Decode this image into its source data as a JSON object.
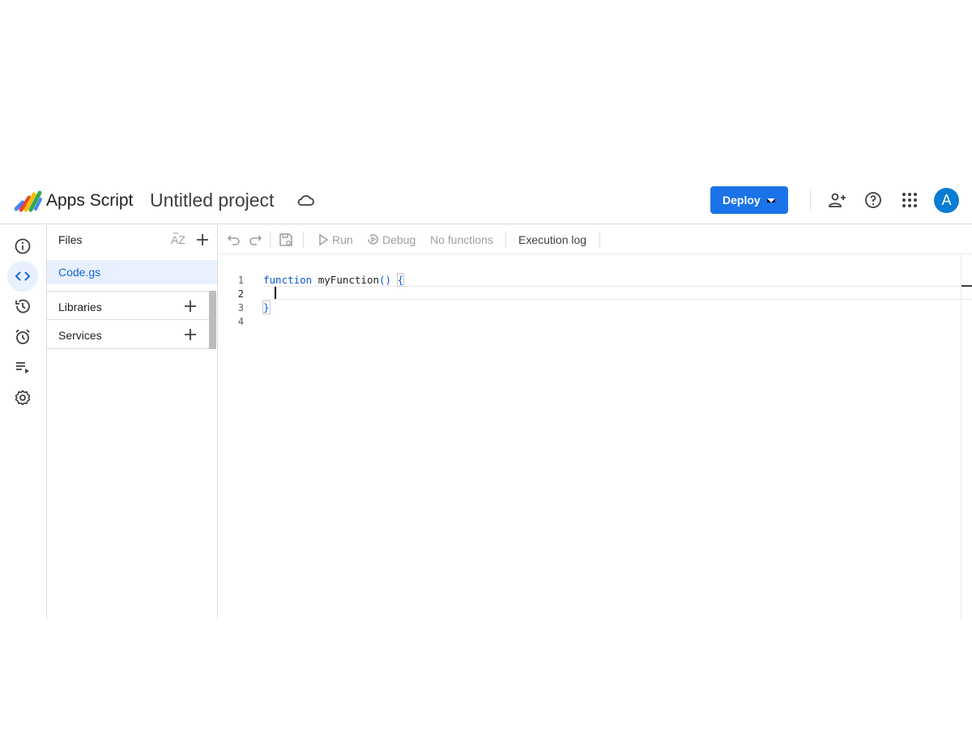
{
  "header": {
    "app_name": "Apps Script",
    "project_title": "Untitled project",
    "deploy_label": "Deploy",
    "avatar_initial": "A",
    "colors": {
      "deploy": "#1a73e8",
      "avatar": "#0b7cd3"
    }
  },
  "rail": {
    "items": [
      {
        "icon": "info-icon",
        "active": false
      },
      {
        "icon": "code-icon",
        "active": true
      },
      {
        "icon": "history-icon",
        "active": false
      },
      {
        "icon": "alarm-icon",
        "active": false
      },
      {
        "icon": "executions-icon",
        "active": false
      },
      {
        "icon": "settings-icon",
        "active": false
      }
    ]
  },
  "files": {
    "title": "Files",
    "items": [
      {
        "name": "Code.gs",
        "selected": true
      }
    ],
    "sections": [
      {
        "label": "Libraries"
      },
      {
        "label": "Services"
      }
    ]
  },
  "toolbar": {
    "run_label": "Run",
    "debug_label": "Debug",
    "function_select": "No functions",
    "execution_log_label": "Execution log"
  },
  "editor": {
    "line_numbers": [
      "1",
      "2",
      "3",
      "4"
    ],
    "code": {
      "kw_function": "function",
      "fn_name": "myFunction",
      "parens": "()",
      "open_brace": "{",
      "close_brace": "}"
    }
  }
}
